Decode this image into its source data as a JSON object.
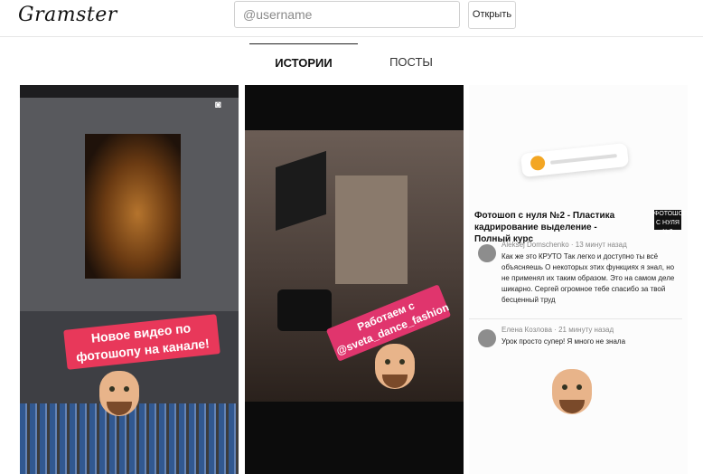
{
  "header": {
    "logo": "Gramster",
    "search_placeholder": "@username",
    "search_value": "",
    "open_button": "Открыть"
  },
  "tabs": {
    "stories": "ИСТОРИИ",
    "posts": "ПОСТЫ"
  },
  "stories": [
    {
      "sticker_text": "Новое видео по фотошопу на канале!"
    },
    {
      "sticker_text": "Работаем с @sveta_dance_fashion"
    },
    {
      "video_title": "Фотошоп с нуля №2 - Пластика кадрирование выделение - Полный курс",
      "thumb_text": "ФОТОШОП С НУЛЯ №2",
      "comments": [
        {
          "name": "Aleksej Domschenko · 13 минут назад",
          "text": "Как же это КРУТО Так легко и доступно ты всё объясняешь О некоторых этих функциях я знал, но не применял их таким образом. Это на самом деле шикарно. Сергей огромное тебе спасибо за твой бесценный труд"
        },
        {
          "name": "Елена Козлова · 21 минуту назад",
          "text": "Урок просто супер! Я много не знала"
        }
      ]
    }
  ],
  "colors": {
    "sticker": "#e8385a",
    "accent": "#111111"
  }
}
